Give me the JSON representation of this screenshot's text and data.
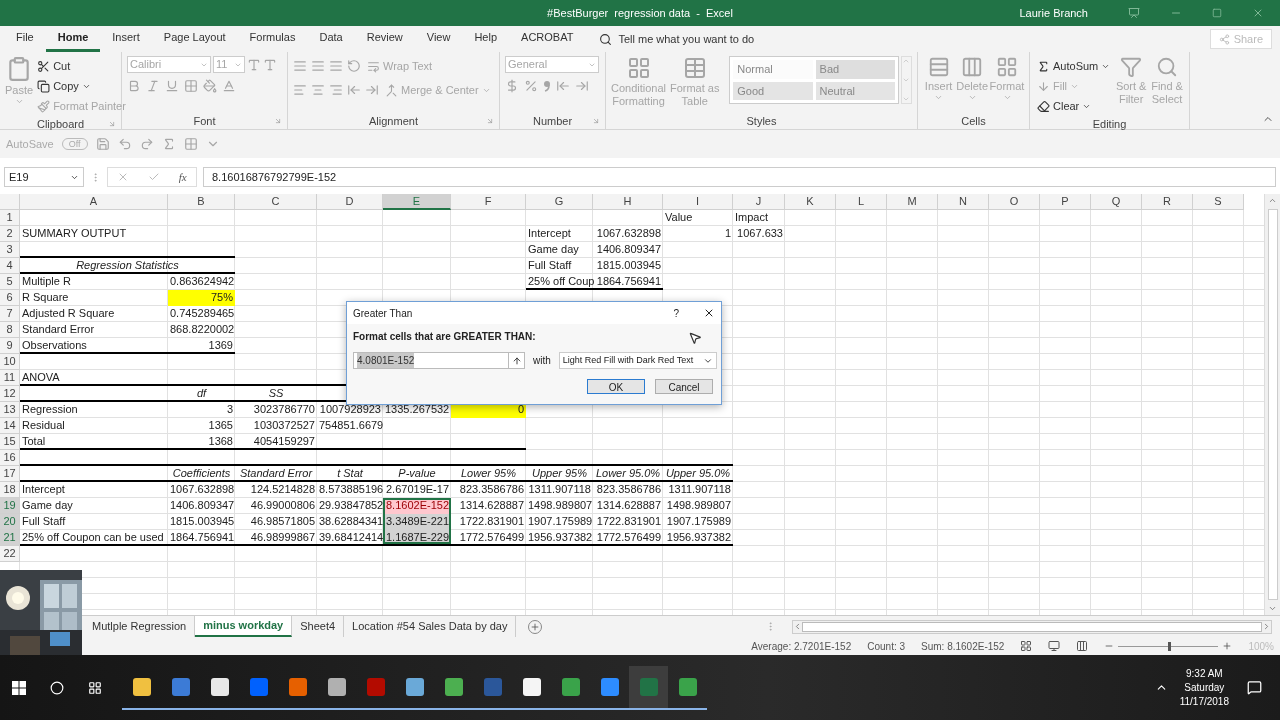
{
  "window": {
    "title": "#BestBurger  regression data  -  Excel",
    "user": "Laurie Branch"
  },
  "tabs": [
    {
      "label": "File",
      "selected": false
    },
    {
      "label": "Home",
      "selected": true
    },
    {
      "label": "Insert",
      "selected": false
    },
    {
      "label": "Page Layout",
      "selected": false
    },
    {
      "label": "Formulas",
      "selected": false
    },
    {
      "label": "Data",
      "selected": false
    },
    {
      "label": "Review",
      "selected": false
    },
    {
      "label": "View",
      "selected": false
    },
    {
      "label": "Help",
      "selected": false
    },
    {
      "label": "ACROBAT",
      "selected": false
    }
  ],
  "tell_me": "Tell me what you want to do",
  "share": "Share",
  "ribbon": {
    "clipboard": {
      "label": "Clipboard",
      "paste": {
        "label": "Paste",
        "disabled": true
      },
      "cut": {
        "label": "Cut",
        "disabled": false
      },
      "copy": {
        "label": "Copy",
        "disabled": false
      },
      "format_painter": {
        "label": "Format Painter",
        "disabled": true
      }
    },
    "font": {
      "label": "Font",
      "name": "Calibri",
      "size": "11"
    },
    "alignment": {
      "label": "Alignment",
      "wrap_text": {
        "label": "Wrap Text",
        "disabled": true
      },
      "merge_center": {
        "label": "Merge & Center",
        "disabled": true
      }
    },
    "number": {
      "label": "Number",
      "format": "General"
    },
    "styles": {
      "label": "Styles",
      "conditional_formatting": {
        "label": "Conditional Formatting",
        "disabled": true
      },
      "format_as_table": {
        "label": "Format as Table",
        "disabled": true
      },
      "gallery": [
        {
          "label": "Normal",
          "color": "#fbfbfb"
        },
        {
          "label": "Bad",
          "color": "#dedede"
        },
        {
          "label": "Good",
          "color": "#e4e4e4"
        },
        {
          "label": "Neutral",
          "color": "#e4e4e4"
        }
      ]
    },
    "cells": {
      "label": "Cells",
      "items": [
        {
          "label": "Insert",
          "disabled": true
        },
        {
          "label": "Delete",
          "disabled": true
        },
        {
          "label": "Format",
          "disabled": true
        }
      ]
    },
    "editing": {
      "label": "Editing",
      "autosum": {
        "label": "AutoSum",
        "disabled": false
      },
      "fill": {
        "label": "Fill",
        "disabled": true
      },
      "clear": {
        "label": "Clear",
        "disabled": false
      },
      "sort_filter": {
        "label": "Sort & Filter",
        "disabled": true
      },
      "find_select": {
        "label": "Find & Select",
        "disabled": true
      }
    }
  },
  "quick_access": {
    "autosave": "AutoSave",
    "toggle": "Off"
  },
  "formula_bar": {
    "name_box": "E19",
    "function_label": "fx",
    "formula": "8.16016876792799E-152"
  },
  "sheet": {
    "columns": [
      {
        "label": "A",
        "selected": false
      },
      {
        "label": "B",
        "selected": false
      },
      {
        "label": "C",
        "selected": false
      },
      {
        "label": "D",
        "selected": false
      },
      {
        "label": "E",
        "selected": true
      },
      {
        "label": "F",
        "selected": false
      },
      {
        "label": "G",
        "selected": false
      },
      {
        "label": "H",
        "selected": false
      },
      {
        "label": "I",
        "selected": false
      },
      {
        "label": "J",
        "selected": false
      },
      {
        "label": "K",
        "selected": false
      },
      {
        "label": "L",
        "selected": false
      },
      {
        "label": "M",
        "selected": false
      },
      {
        "label": "N",
        "selected": false
      },
      {
        "label": "O",
        "selected": false
      },
      {
        "label": "P",
        "selected": false
      },
      {
        "label": "Q",
        "selected": false
      },
      {
        "label": "R",
        "selected": false
      },
      {
        "label": "S",
        "selected": false
      }
    ],
    "rows": [
      {
        "number": "1",
        "selected": false,
        "cells": {
          "I": {
            "text": "Value",
            "kind": "label"
          },
          "J": {
            "text": "Impact",
            "kind": "label"
          }
        }
      },
      {
        "number": "2",
        "selected": false,
        "cells": {
          "A": "SUMMARY OUTPUT",
          "G": {
            "text": "Intercept",
            "kind": "label"
          },
          "H": "1067.632898",
          "I": "1",
          "J": "1067.633"
        }
      },
      {
        "number": "3",
        "selected": false,
        "cells": {
          "A": {
            "underline": true
          },
          "B": {
            "underline": true
          },
          "G": {
            "text": "Game day",
            "kind": "label"
          },
          "H": "1406.809347"
        }
      },
      {
        "number": "4",
        "selected": false,
        "cells": {
          "A": {
            "text": "Regression Statistics",
            "kind": "caption",
            "underline": true
          },
          "G": {
            "text": "Full Staff",
            "kind": "label"
          },
          "H": "1815.003945"
        }
      },
      {
        "number": "5",
        "selected": false,
        "cells": {
          "A": "Multiple R",
          "B": "0.863624942",
          "G": {
            "text": "25% off Coup",
            "kind": "label",
            "underline": true
          },
          "H": {
            "text": "1864.756941",
            "underline": true
          }
        }
      },
      {
        "number": "6",
        "selected": false,
        "cells": {
          "A": "R Square",
          "B": {
            "text": "75%",
            "color": "#ffff00"
          }
        }
      },
      {
        "number": "7",
        "selected": false,
        "cells": {
          "A": "Adjusted R Square",
          "B": "0.745289465"
        }
      },
      {
        "number": "8",
        "selected": false,
        "cells": {
          "A": "Standard Error",
          "B": "868.8220002"
        }
      },
      {
        "number": "9",
        "selected": false,
        "cells": {
          "A": {
            "text": "Observations",
            "underline": true
          },
          "B": {
            "text": "1369",
            "underline": true
          }
        }
      },
      {
        "number": "10",
        "selected": false
      },
      {
        "number": "11",
        "selected": false,
        "cells": {
          "A": {
            "text": "ANOVA",
            "underline": true
          },
          "B": {
            "underline": true
          },
          "C": {
            "underline": true
          },
          "D": {
            "underline": true
          }
        }
      },
      {
        "number": "12",
        "selected": false,
        "kind": "heading",
        "cells": {
          "A": {
            "underline": true
          },
          "B": {
            "text": "df",
            "underline": true
          },
          "C": {
            "text": "SS",
            "underline": true
          },
          "D": {
            "underline": true
          }
        }
      },
      {
        "number": "13",
        "selected": false,
        "cells": {
          "A": "Regression",
          "B": "3",
          "C": "3023786770",
          "D": "1007928923",
          "E": "1335.267532",
          "F": {
            "text": "0",
            "color": "#ffff00"
          }
        }
      },
      {
        "number": "14",
        "selected": false,
        "cells": {
          "A": "Residual",
          "B": "1365",
          "C": "1030372527",
          "D": "754851.6679"
        }
      },
      {
        "number": "15",
        "selected": false,
        "cells": {
          "A": {
            "text": "Total",
            "underline": true
          },
          "B": {
            "text": "1368",
            "underline": true
          },
          "C": {
            "text": "4054159297",
            "underline": true
          },
          "D": {
            "underline": true
          },
          "E": {
            "underline": true
          },
          "F": {
            "underline": true
          }
        }
      },
      {
        "number": "16",
        "selected": false,
        "cells": {
          "A": {
            "underline": true
          },
          "B": {
            "underline": true
          },
          "C": {
            "underline": true
          },
          "D": {
            "underline": true
          },
          "E": {
            "underline": true
          },
          "F": {
            "underline": true
          },
          "G": {
            "underline": true
          },
          "H": {
            "underline": true
          },
          "I": {
            "underline": true
          }
        }
      },
      {
        "number": "17",
        "selected": false,
        "kind": "heading",
        "cells": {
          "A": {
            "underline": true
          },
          "B": {
            "text": "Coefficients",
            "underline": true
          },
          "C": {
            "text": "Standard Error",
            "underline": true
          },
          "D": {
            "text": "t Stat",
            "underline": true
          },
          "E": {
            "text": "P-value",
            "underline": true
          },
          "F": {
            "text": "Lower 95%",
            "underline": true
          },
          "G": {
            "text": "Upper 95%",
            "underline": true
          },
          "H": {
            "text": "Lower 95.0%",
            "underline": true
          },
          "I": {
            "text": "Upper 95.0%",
            "underline": true
          }
        }
      },
      {
        "number": "18",
        "selected": false,
        "cells": {
          "A": "Intercept",
          "B": "1067.632898",
          "C": "124.5214828",
          "D": "8.573885196",
          "E": "2.67019E-17",
          "F": "823.3586786",
          "G": "1311.907118",
          "H": "823.3586786",
          "I": "1311.907118"
        }
      },
      {
        "number": "19",
        "selected": true,
        "cells": {
          "A": "Game day",
          "B": "1406.809347",
          "C": "46.99000806",
          "D": "29.93847852",
          "E": {
            "text": "8.1602E-152",
            "color": "#ffc7ce",
            "kind": "alert"
          },
          "F": "1314.628887",
          "G": "1498.989807",
          "H": "1314.628887",
          "I": "1498.989807"
        }
      },
      {
        "number": "20",
        "selected": true,
        "cells": {
          "A": "Full Staff",
          "B": "1815.003945",
          "C": "46.98571805",
          "D": "38.62884341",
          "E": "3.3489E-221",
          "F": "1722.831901",
          "G": "1907.175989",
          "H": "1722.831901",
          "I": "1907.175989"
        }
      },
      {
        "number": "21",
        "selected": true,
        "cells": {
          "A": {
            "text": "25% off Coupon can be used",
            "underline": true
          },
          "B": {
            "text": "1864.756941",
            "underline": true
          },
          "C": {
            "text": "46.98999867",
            "underline": true
          },
          "D": {
            "text": "39.68412414",
            "underline": true
          },
          "E": {
            "text": "1.1687E-229",
            "underline": true
          },
          "F": {
            "text": "1772.576499",
            "underline": true
          },
          "G": {
            "text": "1956.937382",
            "underline": true
          },
          "H": {
            "text": "1772.576499",
            "underline": true
          },
          "I": {
            "text": "1956.937382",
            "underline": true
          }
        }
      },
      {
        "number": "22",
        "selected": false
      }
    ]
  },
  "dialog": {
    "title": "Greater Than",
    "help": "?",
    "prompt": "Format cells that are GREATER THAN:",
    "value": "4.0801E-152",
    "with": "with",
    "format": "Light Red Fill with Dark Red Text",
    "ok": "OK",
    "cancel": "Cancel"
  },
  "sheet_tabs": [
    {
      "label": "Mutlple Regression",
      "selected": false
    },
    {
      "label": "minus workday",
      "selected": true
    },
    {
      "label": "Sheet4",
      "selected": false
    },
    {
      "label": "Location #54 Sales Data by day",
      "selected": false
    }
  ],
  "status_bar": {
    "average": "Average: 2.7201E-152",
    "count": "Count: 3",
    "sum": "Sum: 8.1602E-152",
    "zoom_slider": {
      "level": 0.5
    },
    "zoom": "100%"
  },
  "taskbar": {
    "apps": [
      {
        "color": "#f0c040",
        "selected": false
      },
      {
        "color": "#3c7bd6",
        "selected": false
      },
      {
        "color": "#e8e8e8",
        "selected": false
      },
      {
        "color": "#0061fe",
        "selected": false
      },
      {
        "color": "#e66000",
        "selected": false
      },
      {
        "color": "#b0b0b0",
        "selected": false
      },
      {
        "color": "#b30b00",
        "selected": false
      },
      {
        "color": "#6aa9d8",
        "selected": false
      },
      {
        "color": "#4caf50",
        "selected": false
      },
      {
        "color": "#2b579a",
        "selected": false
      },
      {
        "color": "#f5f5f5",
        "selected": false
      },
      {
        "color": "#3aa34a",
        "selected": false
      },
      {
        "color": "#2d8cff",
        "selected": false
      },
      {
        "color": "#217346",
        "selected": true
      },
      {
        "color": "#3aa34a",
        "selected": false
      }
    ],
    "time": "9:32 AM",
    "day": "Saturday",
    "date": "11/17/2018"
  }
}
